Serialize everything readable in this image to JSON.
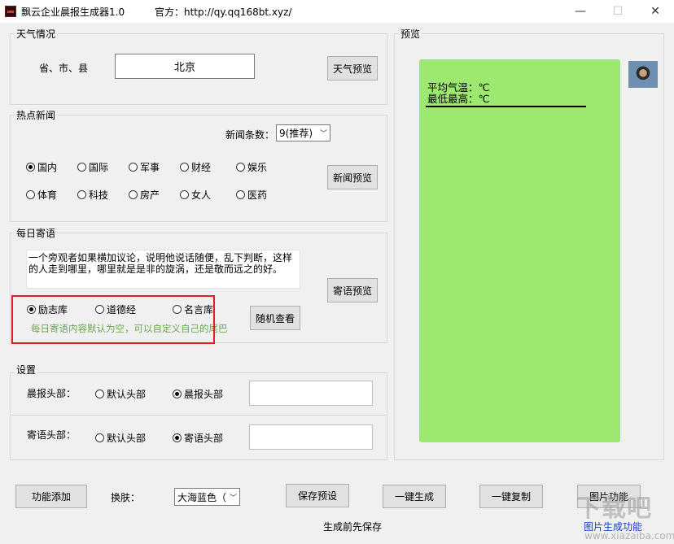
{
  "window": {
    "title": "飘云企业晨报生成器1.0",
    "official": "官方：http://qy.qq168bt.xyz/",
    "minimize": "—",
    "maximize": "☐",
    "close": "✕"
  },
  "weather": {
    "group_label": "天气情况",
    "region_label": "省、市、县",
    "region_value": "北京",
    "preview_button": "天气预览"
  },
  "news": {
    "group_label": "热点新闻",
    "count_label": "新闻条数：",
    "count_value": "9(推荐)",
    "categories": [
      "国内",
      "国际",
      "军事",
      "财经",
      "娱乐",
      "体育",
      "科技",
      "房产",
      "女人",
      "医药"
    ],
    "selected": "国内",
    "preview_button": "新闻预览"
  },
  "quote": {
    "group_label": "每日寄语",
    "text": "一个旁观者如果横加议论，说明他说话随便，乱下判断，这样的人走到哪里，哪里就是是非的旋涡，还是敬而远之的好。",
    "preview_button": "寄语预览",
    "sources": [
      "励志库",
      "道德经",
      "名言库"
    ],
    "selected": "励志库",
    "random_button": "随机查看",
    "hint": "每日寄语内容默认为空，可以自定义自己的尾巴"
  },
  "settings": {
    "group_label": "设置",
    "morning_header_label": "晨报头部：",
    "morning_options": [
      "默认头部",
      "晨报头部"
    ],
    "morning_selected": "晨报头部",
    "morning_input": "",
    "quote_header_label": "寄语头部：",
    "quote_options": [
      "默认头部",
      "寄语头部"
    ],
    "quote_selected": "寄语头部",
    "quote_input": ""
  },
  "preview": {
    "group_label": "预览",
    "line1": "平均气温：℃",
    "line2": "最低最高：℃"
  },
  "bottom": {
    "add_feature": "功能添加",
    "skin_label": "换肤：",
    "skin_value": "大海蓝色（",
    "save_preset": "保存预设",
    "generate": "一键生成",
    "copy": "一键复制",
    "image_feature": "图片功能",
    "save_hint": "生成前先保存",
    "image_link": "图片生成功能"
  },
  "watermark": {
    "text": "下载吧",
    "sub": "www.xiazaiba.com"
  },
  "colors": {
    "preview_bubble": "#9de870",
    "hint_text": "#6aa84f",
    "highlight_box": "#e02020",
    "link": "#1a3fbf"
  }
}
